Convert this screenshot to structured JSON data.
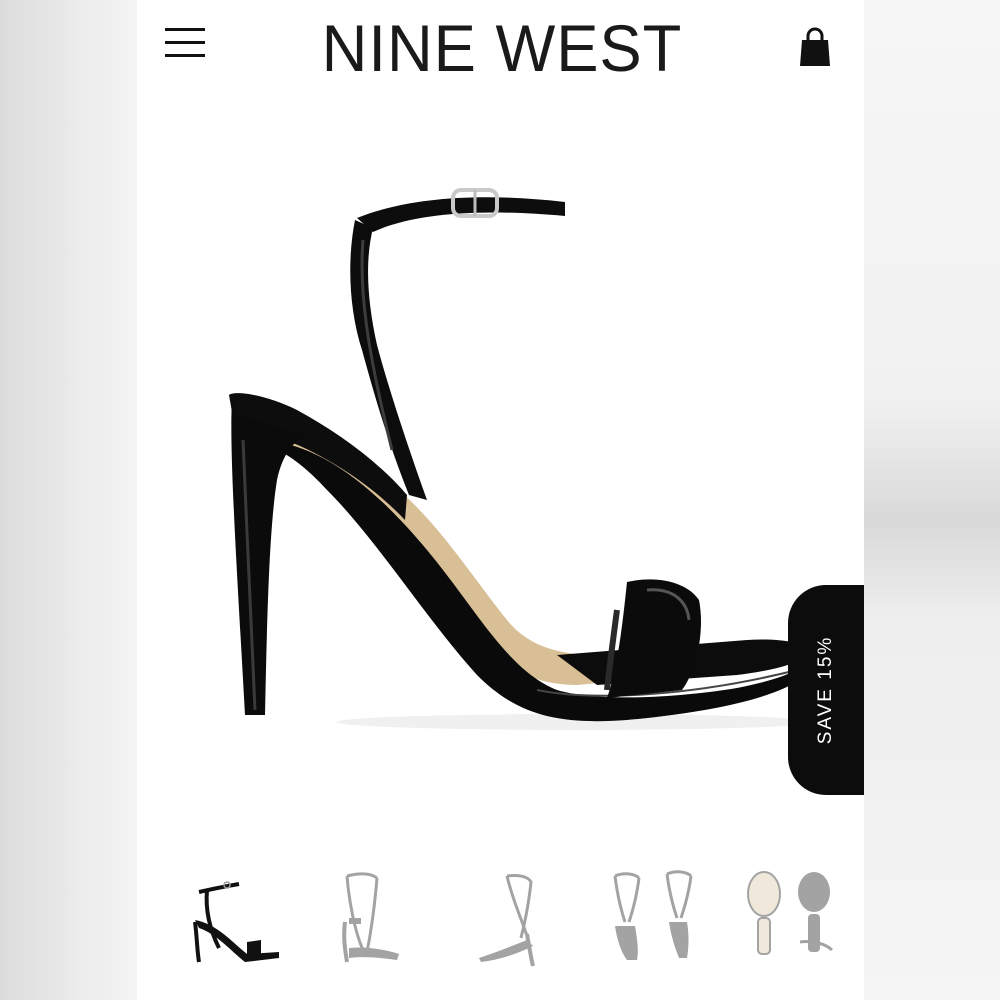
{
  "header": {
    "brand": "NINE WEST",
    "menu_icon": "hamburger-menu-icon",
    "bag_icon": "shopping-bag-icon"
  },
  "product": {
    "image": "black-patent-platform-stiletto-sandal",
    "promo_badge": "SAVE 15%"
  },
  "thumbnails": [
    {
      "view": "side",
      "active": true
    },
    {
      "view": "front-angle",
      "active": false
    },
    {
      "view": "rear-angle",
      "active": false
    },
    {
      "view": "front-and-back-pair",
      "active": false
    },
    {
      "view": "soles-top",
      "active": false
    }
  ],
  "colors": {
    "badge_bg": "#0c0c0c",
    "badge_text": "#ffffff",
    "brand_text": "#1a1a1a",
    "background": "#ffffff"
  }
}
